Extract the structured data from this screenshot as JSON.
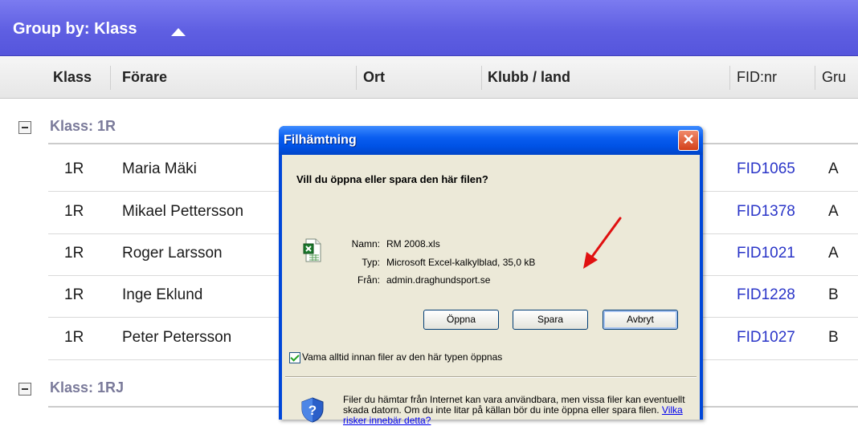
{
  "group_by": {
    "label": "Group by: Klass"
  },
  "columns": [
    "Klass",
    "Förare",
    "Ort",
    "Klubb / land",
    "FID:nr",
    "Gru"
  ],
  "groups": [
    {
      "label": "Klass: 1R",
      "rows": [
        {
          "klass": "1R",
          "forare": "Maria Mäki",
          "fid": "FID1065",
          "grupp": "A"
        },
        {
          "klass": "1R",
          "forare": "Mikael Pettersson",
          "fid": "FID1378",
          "grupp": "A"
        },
        {
          "klass": "1R",
          "forare": "Roger Larsson",
          "fid": "FID1021",
          "grupp": "A"
        },
        {
          "klass": "1R",
          "forare": "Inge Eklund",
          "fid": "FID1228",
          "grupp": "B"
        },
        {
          "klass": "1R",
          "forare": "Peter Petersson",
          "fid": "FID1027",
          "grupp": "B"
        }
      ]
    },
    {
      "label": "Klass: 1RJ",
      "rows": []
    }
  ],
  "dialog": {
    "title": "Filhämtning",
    "close_label": "✕",
    "question": "Vill du öppna eller spara den här filen?",
    "info": [
      {
        "key": "Namn:",
        "value": "RM 2008.xls"
      },
      {
        "key": "Typ:",
        "value": "Microsoft Excel-kalkylblad, 35,0 kB"
      },
      {
        "key": "Från:",
        "value": "admin.draghundsport.se"
      }
    ],
    "buttons": {
      "open": "Öppna",
      "save": "Spara",
      "cancel": "Avbryt"
    },
    "checkbox_label": "Vama alltid innan filer av den här typen öppnas",
    "warning_text": "Filer du hämtar från Internet kan vara användbara, men vissa filer kan eventuellt skada datorn. Om du inte litar på källan bör du inte öppna eller spara filen.",
    "warning_link": "Vilka risker innebär detta?"
  }
}
